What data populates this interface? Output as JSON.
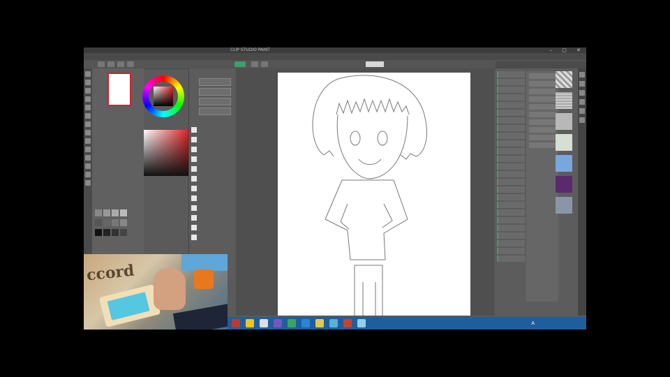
{
  "app": {
    "title": "CLIP STUDIO PAINT",
    "menu": [
      "",
      "",
      "",
      "",
      "",
      "",
      "",
      "",
      "",
      ""
    ],
    "command_field": ""
  },
  "colors": {
    "accent": "#3d9f6a",
    "taskbar": "#1f5e9c",
    "selected_color": "#d22222"
  },
  "left_panel": {
    "subtool_rows": [
      "",
      "",
      "",
      "",
      "",
      "",
      "",
      "",
      "",
      "",
      "",
      ""
    ]
  },
  "right_panel": {
    "layers": [
      "",
      "",
      "",
      "",
      "",
      "",
      "",
      "",
      "",
      "",
      "",
      "",
      "",
      "",
      "",
      "",
      "",
      "",
      "",
      "",
      "",
      "",
      "",
      "",
      ""
    ],
    "materials": [
      "",
      "",
      "",
      "",
      "",
      "",
      "",
      "",
      "",
      "",
      "",
      "",
      "",
      ""
    ]
  },
  "taskbar": {
    "lang": "A",
    "time": "",
    "date": "",
    "icons": [
      "browser-icon",
      "explorer-icon",
      "store-icon",
      "mail-icon",
      "chrome-icon",
      "paint-icon",
      "clip-studio-icon",
      "folder-icon",
      "media-icon",
      "settings-icon"
    ]
  },
  "webcam": {
    "caption": "ccord"
  }
}
